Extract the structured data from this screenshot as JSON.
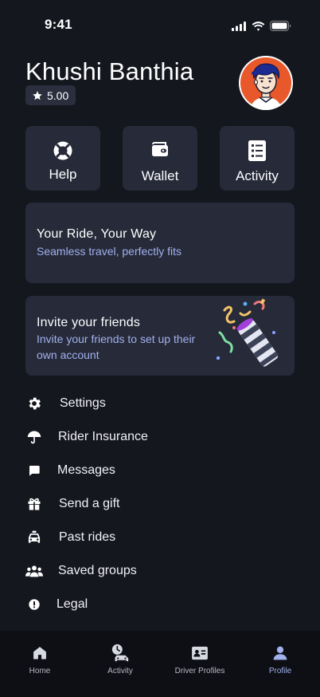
{
  "status_bar": {
    "time": "9:41"
  },
  "profile": {
    "name": "Khushi Banthia",
    "rating": "5.00"
  },
  "quick_actions": [
    {
      "label": "Help",
      "icon": "lifebuoy-icon"
    },
    {
      "label": "Wallet",
      "icon": "wallet-icon"
    },
    {
      "label": "Activity",
      "icon": "list-icon"
    }
  ],
  "promo_card": {
    "title": "Your Ride, Your Way",
    "subtitle": "Seamless travel, perfectly fits"
  },
  "invite_card": {
    "title": "Invite your friends",
    "subtitle_line1": "Invite your friends to set up their",
    "subtitle_line2": "own account"
  },
  "menu": [
    {
      "label": "Settings",
      "icon": "gear-icon"
    },
    {
      "label": "Rider Insurance",
      "icon": "umbrella-icon"
    },
    {
      "label": "Messages",
      "icon": "message-icon"
    },
    {
      "label": "Send a gift",
      "icon": "gift-icon"
    },
    {
      "label": "Past rides",
      "icon": "car-icon"
    },
    {
      "label": "Saved groups",
      "icon": "group-icon"
    },
    {
      "label": "Legal",
      "icon": "alert-icon"
    }
  ],
  "bottom_nav": [
    {
      "label": "Home",
      "icon": "home-icon"
    },
    {
      "label": "Activity",
      "icon": "activity-icon"
    },
    {
      "label": "Driver Profiles",
      "icon": "id-card-icon"
    },
    {
      "label": "Profile",
      "icon": "person-icon",
      "active": true
    }
  ],
  "colors": {
    "background": "#15171f",
    "card": "#262a39",
    "accent": "#a3b1ee",
    "avatar_ring": "#e8582a"
  }
}
